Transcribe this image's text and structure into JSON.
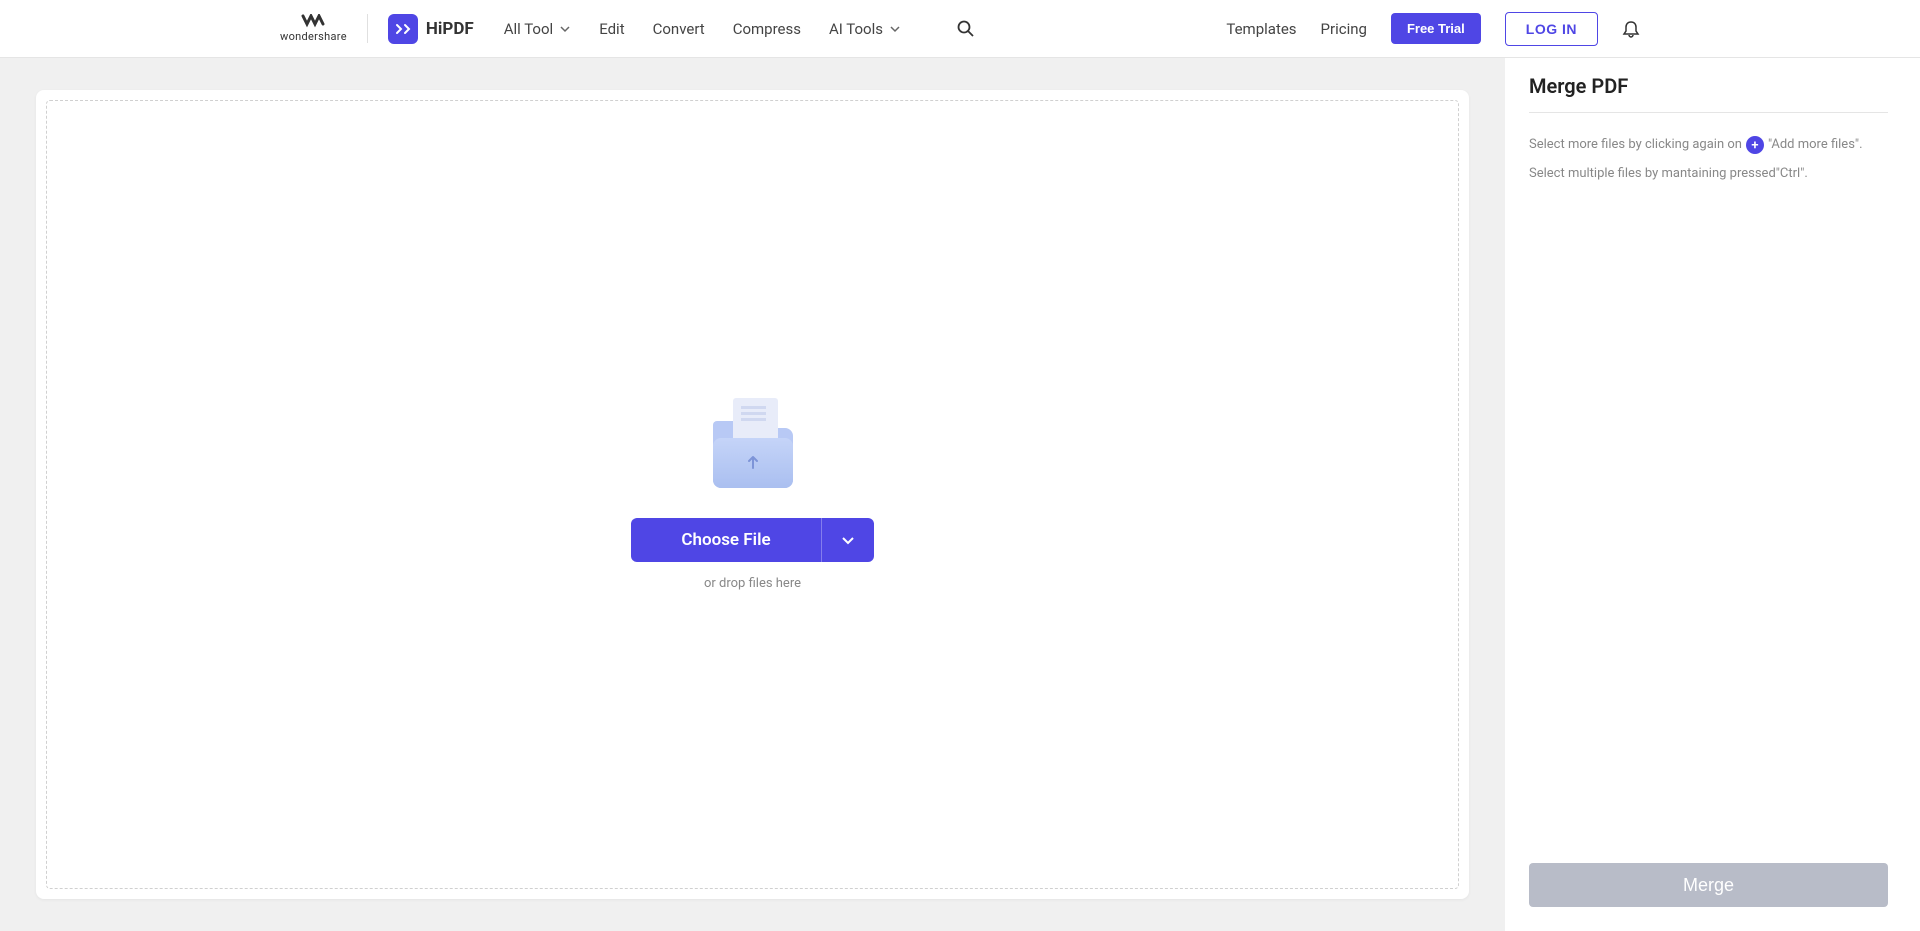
{
  "header": {
    "wondershare_label": "wondershare",
    "hipdf_label": "HiPDF",
    "nav": {
      "all_tool": "All Tool",
      "edit": "Edit",
      "convert": "Convert",
      "compress": "Compress",
      "ai_tools": "AI Tools"
    },
    "templates": "Templates",
    "pricing": "Pricing",
    "free_trial": "Free Trial",
    "login": "LOG IN"
  },
  "upload": {
    "choose_file": "Choose File",
    "drop_hint": "or drop files here"
  },
  "panel": {
    "title": "Merge PDF",
    "hint_part1": "Select more files by clicking again on ",
    "hint_part2": "\"Add more files\".",
    "hint_line2": "Select multiple files by mantaining pressed\"Ctrl\".",
    "merge_btn": "Merge"
  }
}
